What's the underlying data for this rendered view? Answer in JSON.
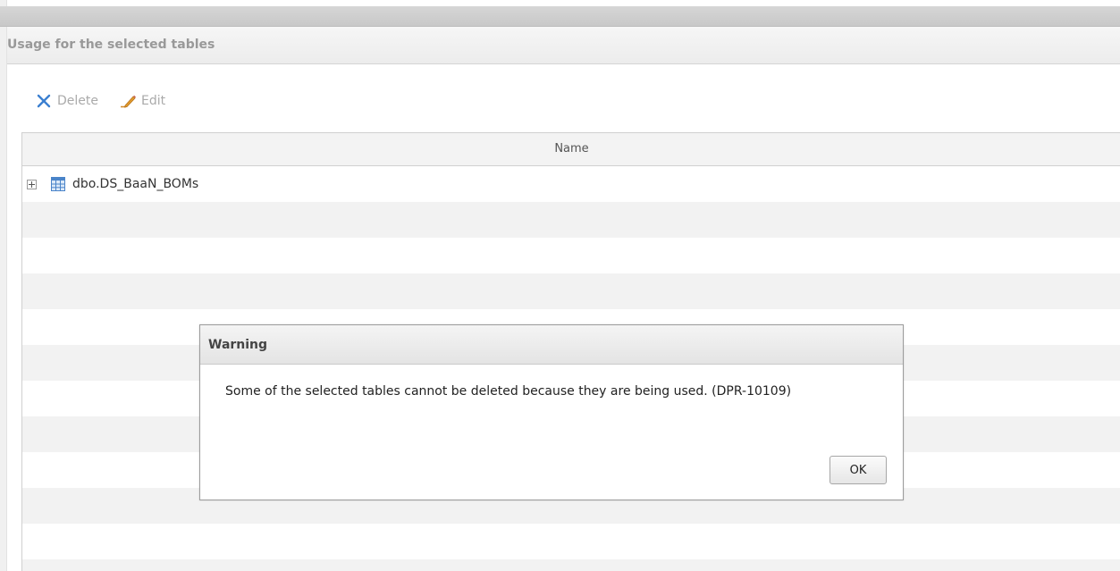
{
  "panel": {
    "title": "Usage for the selected tables"
  },
  "toolbar": {
    "delete_label": "Delete",
    "delete_icon": "delete-x-icon",
    "edit_label": "Edit",
    "edit_icon": "pencil-icon"
  },
  "grid": {
    "columns": [
      "Name"
    ],
    "rows": [
      {
        "name": "dbo.DS_BaaN_BOMs",
        "expander_icon": "plus-expander-icon",
        "type_icon": "table-icon"
      }
    ]
  },
  "dialog": {
    "title": "Warning",
    "message": "Some of the selected tables cannot be deleted because they are being used. (DPR-10109)",
    "ok_label": "OK"
  },
  "colors": {
    "accent_blue": "#3b7fd0",
    "disabled_text": "#aaaaaa",
    "row_stripe": "#f2f2f2"
  }
}
